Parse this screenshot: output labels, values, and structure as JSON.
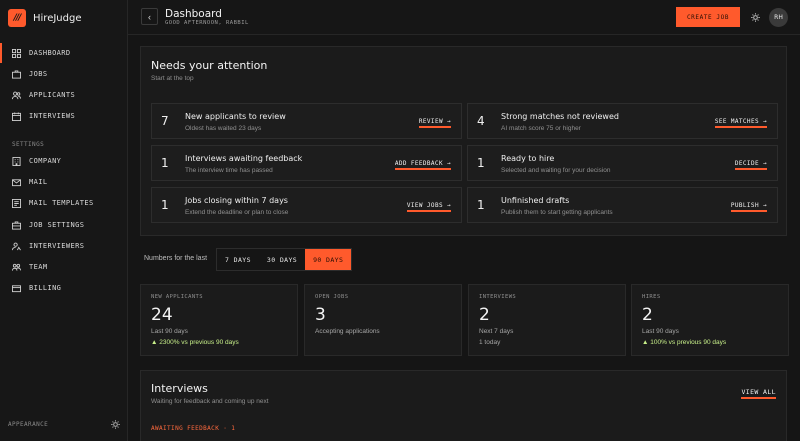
{
  "app": {
    "name": "HireJudge",
    "logo_text": "///"
  },
  "sidebar": {
    "items": [
      {
        "label": "DASHBOARD",
        "icon": "grid-icon"
      },
      {
        "label": "JOBS",
        "icon": "briefcase-icon"
      },
      {
        "label": "APPLICANTS",
        "icon": "users-icon"
      },
      {
        "label": "INTERVIEWS",
        "icon": "calendar-icon"
      }
    ],
    "settings_heading": "SETTINGS",
    "settings_items": [
      {
        "label": "COMPANY",
        "icon": "building-icon"
      },
      {
        "label": "MAIL",
        "icon": "mail-icon"
      },
      {
        "label": "MAIL TEMPLATES",
        "icon": "template-icon"
      },
      {
        "label": "JOB SETTINGS",
        "icon": "settings-icon"
      },
      {
        "label": "INTERVIEWERS",
        "icon": "interviewer-icon"
      },
      {
        "label": "TEAM",
        "icon": "team-icon"
      },
      {
        "label": "BILLING",
        "icon": "card-icon"
      }
    ],
    "appearance": "APPEARANCE"
  },
  "header": {
    "title": "Dashboard",
    "greeting": "GOOD AFTERNOON, RABBIL",
    "create_label": "CREATE JOB",
    "avatar_initials": "RH",
    "back_glyph": "‹"
  },
  "attention": {
    "title": "Needs your attention",
    "subtitle": "Start at the top",
    "tasks": [
      {
        "count": "7",
        "title": "New applicants to review",
        "desc": "Oldest has waited 23 days",
        "action": "REVIEW →"
      },
      {
        "count": "4",
        "title": "Strong matches not reviewed",
        "desc": "AI match score 75 or higher",
        "action": "SEE MATCHES →"
      },
      {
        "count": "1",
        "title": "Interviews awaiting feedback",
        "desc": "The interview time has passed",
        "action": "ADD FEEDBACK →"
      },
      {
        "count": "1",
        "title": "Ready to hire",
        "desc": "Selected and waiting for your decision",
        "action": "DECIDE →"
      },
      {
        "count": "1",
        "title": "Jobs closing within 7 days",
        "desc": "Extend the deadline or plan to close",
        "action": "VIEW JOBS →"
      },
      {
        "count": "1",
        "title": "Unfinished drafts",
        "desc": "Publish them to start getting applicants",
        "action": "PUBLISH →"
      }
    ]
  },
  "range": {
    "label": "Numbers for the last",
    "options": [
      "7 DAYS",
      "30 DAYS",
      "90 DAYS"
    ],
    "selected": "90 DAYS"
  },
  "stats": [
    {
      "label": "NEW APPLICANTS",
      "value": "24",
      "sub": "Last 90 days",
      "delta": "▲ 2300% vs previous 90 days"
    },
    {
      "label": "OPEN JOBS",
      "value": "3",
      "sub": "Accepting applications",
      "delta": ""
    },
    {
      "label": "INTERVIEWS",
      "value": "2",
      "sub": "Next 7 days",
      "delta": "1 today"
    },
    {
      "label": "HIRES",
      "value": "2",
      "sub": "Last 90 days",
      "delta": "▲ 100% vs previous 90 days"
    }
  ],
  "interviews": {
    "title": "Interviews",
    "subtitle": "Waiting for feedback and coming up next",
    "view_all": "VIEW ALL",
    "awaiting_label": "AWAITING FEEDBACK · 1"
  },
  "colors": {
    "accent": "#ff5a2c",
    "positive": "#c8f08a",
    "background": "#151515"
  }
}
